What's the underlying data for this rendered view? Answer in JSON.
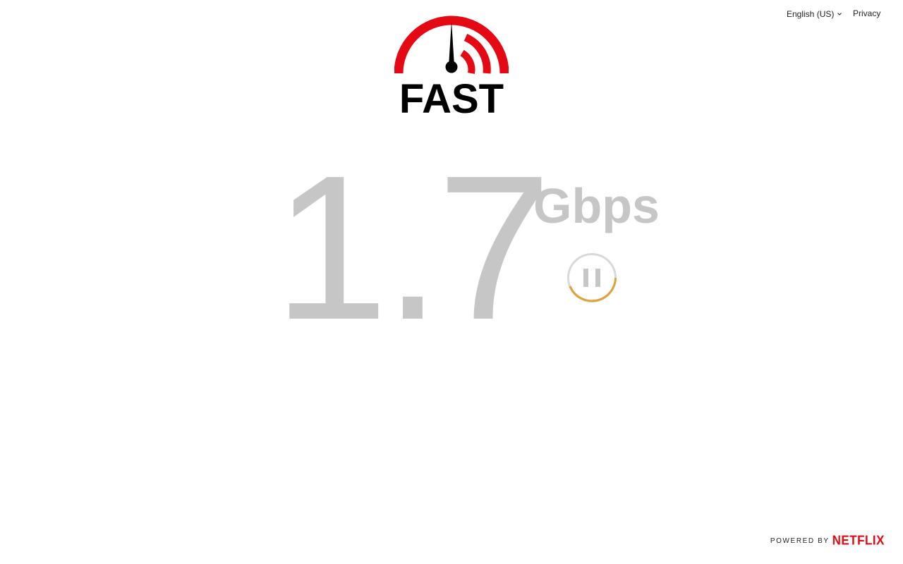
{
  "nav": {
    "language": "English (US)",
    "privacy": "Privacy"
  },
  "logo": {
    "text": "FAST",
    "arc_color": "#e50914"
  },
  "speed": {
    "value": "1.7",
    "units": "Gbps"
  },
  "pause_button": {
    "icon": "pause-icon",
    "ring_color": "#e0a33a"
  },
  "footer": {
    "powered_by": "POWERED BY",
    "brand": "NETFLIX",
    "brand_color": "#e50914"
  }
}
